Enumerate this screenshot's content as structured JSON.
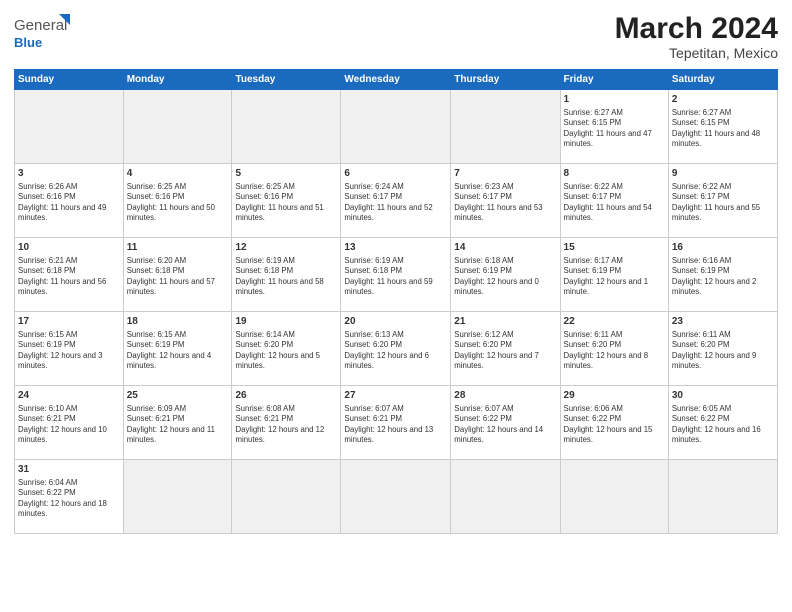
{
  "header": {
    "logo_general": "General",
    "logo_blue": "Blue",
    "title": "March 2024",
    "subtitle": "Tepetitan, Mexico"
  },
  "days_of_week": [
    "Sunday",
    "Monday",
    "Tuesday",
    "Wednesday",
    "Thursday",
    "Friday",
    "Saturday"
  ],
  "weeks": [
    [
      {
        "day": "",
        "info": ""
      },
      {
        "day": "",
        "info": ""
      },
      {
        "day": "",
        "info": ""
      },
      {
        "day": "",
        "info": ""
      },
      {
        "day": "",
        "info": ""
      },
      {
        "day": "1",
        "info": "Sunrise: 6:27 AM\nSunset: 6:15 PM\nDaylight: 11 hours and 47 minutes."
      },
      {
        "day": "2",
        "info": "Sunrise: 6:27 AM\nSunset: 6:15 PM\nDaylight: 11 hours and 48 minutes."
      }
    ],
    [
      {
        "day": "3",
        "info": "Sunrise: 6:26 AM\nSunset: 6:16 PM\nDaylight: 11 hours and 49 minutes."
      },
      {
        "day": "4",
        "info": "Sunrise: 6:25 AM\nSunset: 6:16 PM\nDaylight: 11 hours and 50 minutes."
      },
      {
        "day": "5",
        "info": "Sunrise: 6:25 AM\nSunset: 6:16 PM\nDaylight: 11 hours and 51 minutes."
      },
      {
        "day": "6",
        "info": "Sunrise: 6:24 AM\nSunset: 6:17 PM\nDaylight: 11 hours and 52 minutes."
      },
      {
        "day": "7",
        "info": "Sunrise: 6:23 AM\nSunset: 6:17 PM\nDaylight: 11 hours and 53 minutes."
      },
      {
        "day": "8",
        "info": "Sunrise: 6:22 AM\nSunset: 6:17 PM\nDaylight: 11 hours and 54 minutes."
      },
      {
        "day": "9",
        "info": "Sunrise: 6:22 AM\nSunset: 6:17 PM\nDaylight: 11 hours and 55 minutes."
      }
    ],
    [
      {
        "day": "10",
        "info": "Sunrise: 6:21 AM\nSunset: 6:18 PM\nDaylight: 11 hours and 56 minutes."
      },
      {
        "day": "11",
        "info": "Sunrise: 6:20 AM\nSunset: 6:18 PM\nDaylight: 11 hours and 57 minutes."
      },
      {
        "day": "12",
        "info": "Sunrise: 6:19 AM\nSunset: 6:18 PM\nDaylight: 11 hours and 58 minutes."
      },
      {
        "day": "13",
        "info": "Sunrise: 6:19 AM\nSunset: 6:18 PM\nDaylight: 11 hours and 59 minutes."
      },
      {
        "day": "14",
        "info": "Sunrise: 6:18 AM\nSunset: 6:19 PM\nDaylight: 12 hours and 0 minutes."
      },
      {
        "day": "15",
        "info": "Sunrise: 6:17 AM\nSunset: 6:19 PM\nDaylight: 12 hours and 1 minute."
      },
      {
        "day": "16",
        "info": "Sunrise: 6:16 AM\nSunset: 6:19 PM\nDaylight: 12 hours and 2 minutes."
      }
    ],
    [
      {
        "day": "17",
        "info": "Sunrise: 6:15 AM\nSunset: 6:19 PM\nDaylight: 12 hours and 3 minutes."
      },
      {
        "day": "18",
        "info": "Sunrise: 6:15 AM\nSunset: 6:19 PM\nDaylight: 12 hours and 4 minutes."
      },
      {
        "day": "19",
        "info": "Sunrise: 6:14 AM\nSunset: 6:20 PM\nDaylight: 12 hours and 5 minutes."
      },
      {
        "day": "20",
        "info": "Sunrise: 6:13 AM\nSunset: 6:20 PM\nDaylight: 12 hours and 6 minutes."
      },
      {
        "day": "21",
        "info": "Sunrise: 6:12 AM\nSunset: 6:20 PM\nDaylight: 12 hours and 7 minutes."
      },
      {
        "day": "22",
        "info": "Sunrise: 6:11 AM\nSunset: 6:20 PM\nDaylight: 12 hours and 8 minutes."
      },
      {
        "day": "23",
        "info": "Sunrise: 6:11 AM\nSunset: 6:20 PM\nDaylight: 12 hours and 9 minutes."
      }
    ],
    [
      {
        "day": "24",
        "info": "Sunrise: 6:10 AM\nSunset: 6:21 PM\nDaylight: 12 hours and 10 minutes."
      },
      {
        "day": "25",
        "info": "Sunrise: 6:09 AM\nSunset: 6:21 PM\nDaylight: 12 hours and 11 minutes."
      },
      {
        "day": "26",
        "info": "Sunrise: 6:08 AM\nSunset: 6:21 PM\nDaylight: 12 hours and 12 minutes."
      },
      {
        "day": "27",
        "info": "Sunrise: 6:07 AM\nSunset: 6:21 PM\nDaylight: 12 hours and 13 minutes."
      },
      {
        "day": "28",
        "info": "Sunrise: 6:07 AM\nSunset: 6:22 PM\nDaylight: 12 hours and 14 minutes."
      },
      {
        "day": "29",
        "info": "Sunrise: 6:06 AM\nSunset: 6:22 PM\nDaylight: 12 hours and 15 minutes."
      },
      {
        "day": "30",
        "info": "Sunrise: 6:05 AM\nSunset: 6:22 PM\nDaylight: 12 hours and 16 minutes."
      }
    ],
    [
      {
        "day": "31",
        "info": "Sunrise: 6:04 AM\nSunset: 6:22 PM\nDaylight: 12 hours and 18 minutes."
      },
      {
        "day": "",
        "info": ""
      },
      {
        "day": "",
        "info": ""
      },
      {
        "day": "",
        "info": ""
      },
      {
        "day": "",
        "info": ""
      },
      {
        "day": "",
        "info": ""
      },
      {
        "day": "",
        "info": ""
      }
    ]
  ]
}
